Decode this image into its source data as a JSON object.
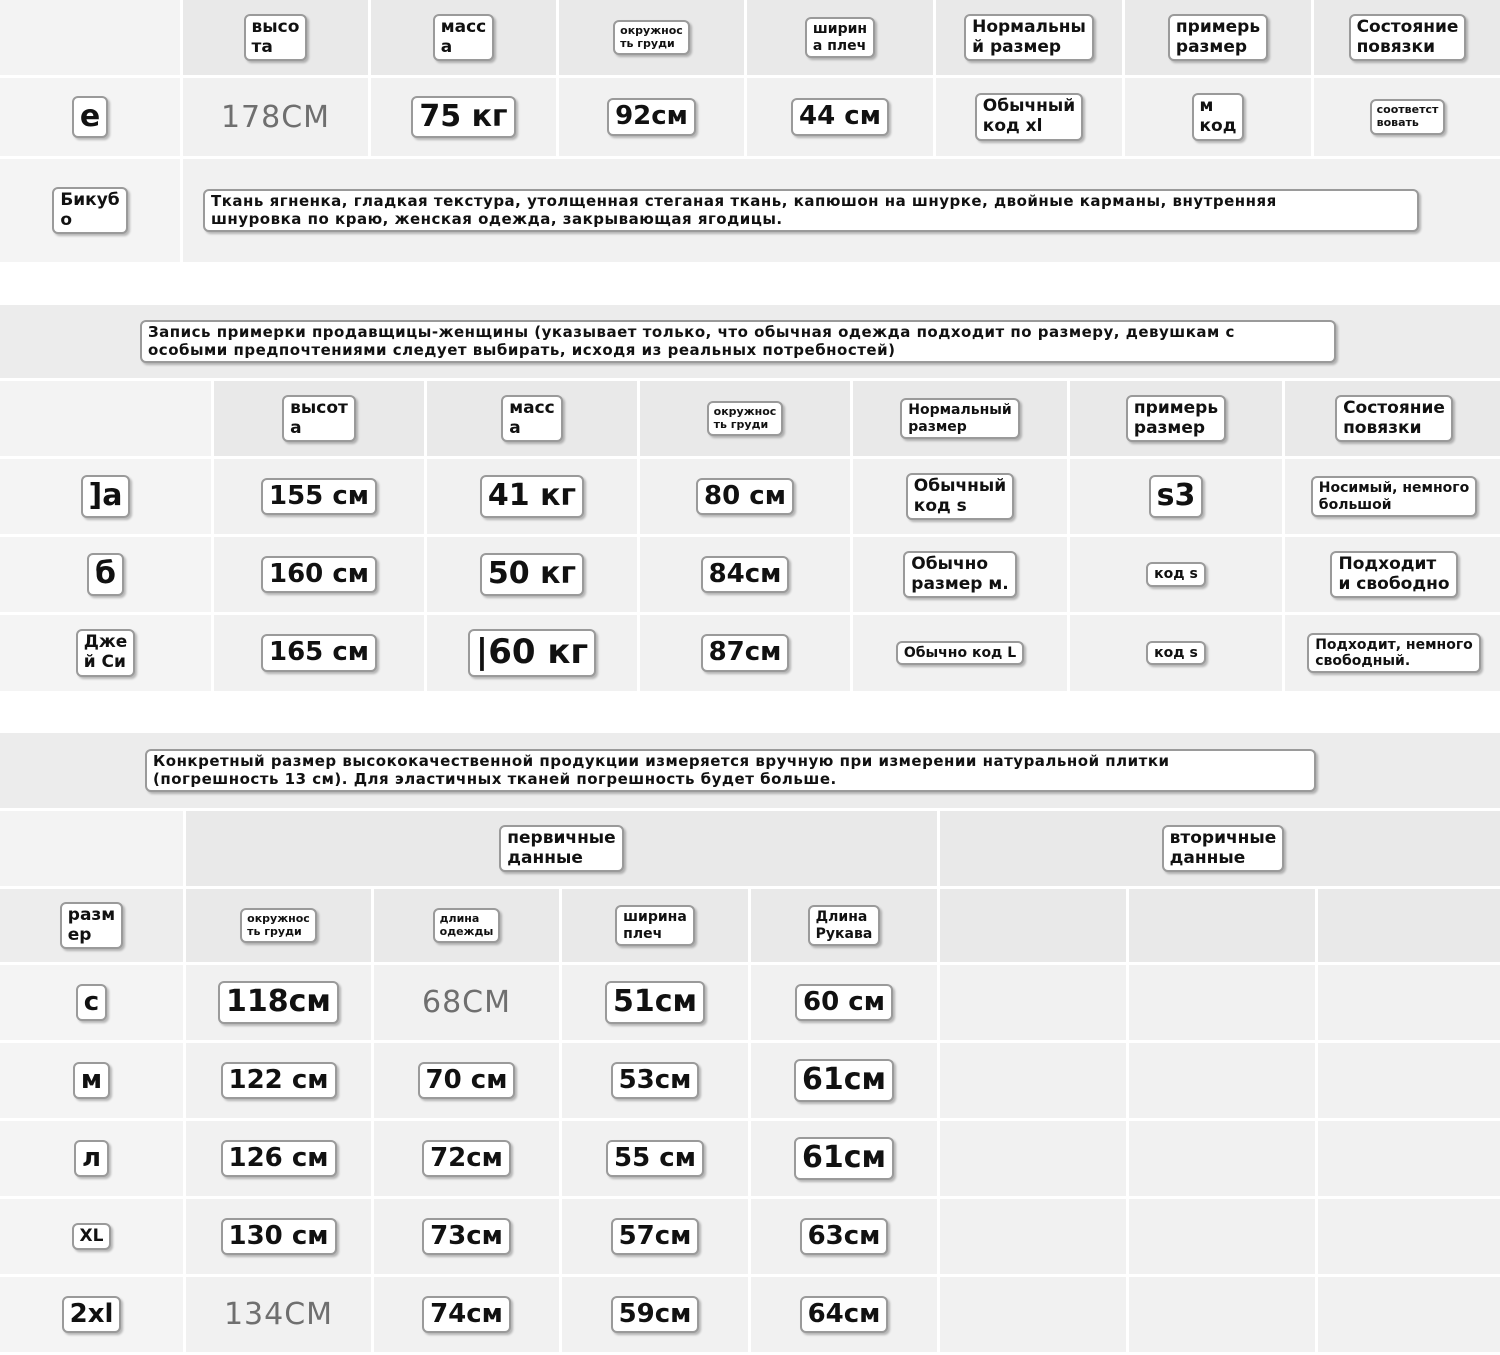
{
  "sec1": {
    "headers": [
      "высо\nта",
      "масс\nа",
      "окружнос\nть груди",
      "ширин\nа плеч",
      "Нормальны\nй размер",
      "примерь\nразмер",
      "Состояние\nповязки"
    ],
    "row": {
      "label": "е",
      "height": "178CM",
      "weight": "75 кг",
      "chest": "92см",
      "shoulder": "44 см",
      "normal": "Обычный\nкод xl",
      "fitting": "м\nкод",
      "state": "соответст\nвовать"
    },
    "desc_label": "Бикуб\nо",
    "desc": "Ткань ягненка, гладкая текстура, утолщенная стеганая ткань, капюшон на шнурке, двойные карманы, внутренняя\nшнуровка по краю, женская одежда, закрывающая ягодицы."
  },
  "sec2": {
    "title": "Запись примерки продавщицы-женщины (указывает только, что обычная одежда подходит по размеру, девушкам с\nособыми предпочтениями следует выбирать, исходя из реальных потребностей)",
    "headers": [
      "высот\nа",
      "масс\nа",
      "окружнос\nть груди",
      "Нормальный\nразмер",
      "примерь\nразмер",
      "Состояние\nповязки"
    ],
    "rows": [
      {
        "label": "]а",
        "height": "155 см",
        "weight": "41 кг",
        "chest": "80 см",
        "normal": "Обычный\nкод s",
        "fitting": "s3",
        "state": "Носимый, немного\nбольшой"
      },
      {
        "label": "б",
        "height": "160 см",
        "weight": "50 кг",
        "chest": "84см",
        "normal": "Обычно\nразмер м.",
        "fitting": "код s",
        "state": "Подходит\nи свободно"
      },
      {
        "label": "Дже\nй Си",
        "height": "165 см",
        "weight": "|60 кг",
        "chest": "87см",
        "normal": "Обычно код L",
        "fitting": "код s",
        "state": "Подходит, немного\nсвободный."
      }
    ]
  },
  "sec3": {
    "note": "Конкретный размер высококачественной продукции измеряется вручную при измерении натуральной плитки\n(погрешность 13 см). Для эластичных тканей погрешность будет больше.",
    "primary": "первичные\nданные",
    "secondary": "вторичные\nданные",
    "headers": [
      "разм\nер",
      "окружнос\nть груди",
      "длина\nодежды",
      "ширина\nплеч",
      "Длина\nРукава"
    ],
    "rows": [
      {
        "size": "с",
        "chest": "118см",
        "length": "68CM",
        "shoulder": "51см",
        "sleeve": "60 см"
      },
      {
        "size": "м",
        "chest": "122 см",
        "length": "70 см",
        "shoulder": "53см",
        "sleeve": "61см"
      },
      {
        "size": "л",
        "chest": "126 см",
        "length": "72см",
        "shoulder": "55 см",
        "sleeve": "61см"
      },
      {
        "size": "XL",
        "chest": "130 см",
        "length": "73см",
        "shoulder": "57см",
        "sleeve": "63см"
      },
      {
        "size": "2xl",
        "chest": "134CM",
        "length": "74см",
        "shoulder": "59см",
        "sleeve": "64см"
      }
    ]
  }
}
